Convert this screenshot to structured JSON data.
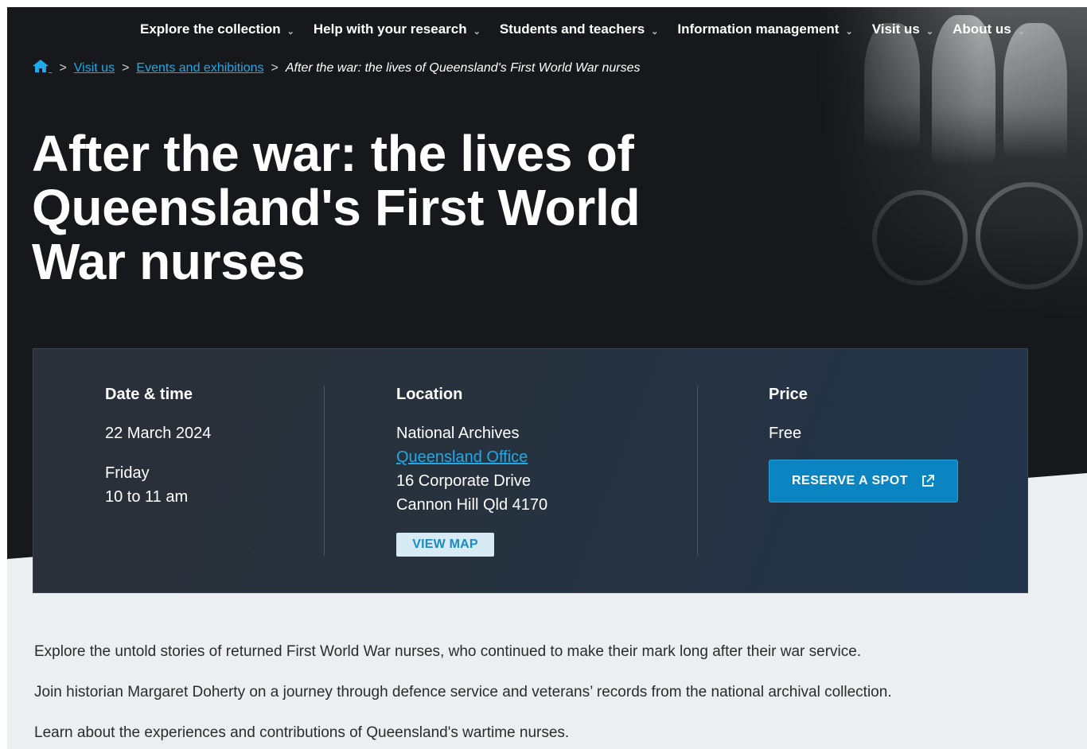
{
  "nav": {
    "items": [
      {
        "label": "Explore the collection"
      },
      {
        "label": "Help with your research"
      },
      {
        "label": "Students and teachers"
      },
      {
        "label": "Information management"
      },
      {
        "label": "Visit us"
      },
      {
        "label": "About us"
      }
    ]
  },
  "breadcrumb": {
    "home_icon": "home-icon",
    "sep": ">",
    "items": [
      "Visit us",
      "Events and exhibitions"
    ],
    "current": "After the war: the lives of Queensland's First World War nurses"
  },
  "page": {
    "title": "After the war: the lives of Queensland's First World War nurses"
  },
  "event": {
    "date": {
      "heading": "Date & time",
      "date": "22 March 2024",
      "day": "Friday",
      "time": "10 to 11 am"
    },
    "location": {
      "heading": "Location",
      "line1": "National Archives",
      "link": "Queensland Office",
      "line3": "16 Corporate Drive",
      "line4": "Cannon Hill Qld 4170",
      "map_button": "VIEW MAP"
    },
    "price": {
      "heading": "Price",
      "value": "Free",
      "reserve_button": "RESERVE A SPOT",
      "reserve_icon": "external-link-icon"
    }
  },
  "content": {
    "paragraphs": [
      "Explore the untold stories of returned First World War nurses, who continued to make their mark long after their war service.",
      "Join historian Margaret Doherty on a journey through defence service and veterans’ records from the national archival collection.",
      "Learn about the experiences and contributions of Queensland's wartime nurses."
    ]
  },
  "colors": {
    "hero_bg": "#16181b",
    "link": "#1fa9e6",
    "primary_button": "#0a85c2",
    "page_bg": "#eceff1"
  }
}
